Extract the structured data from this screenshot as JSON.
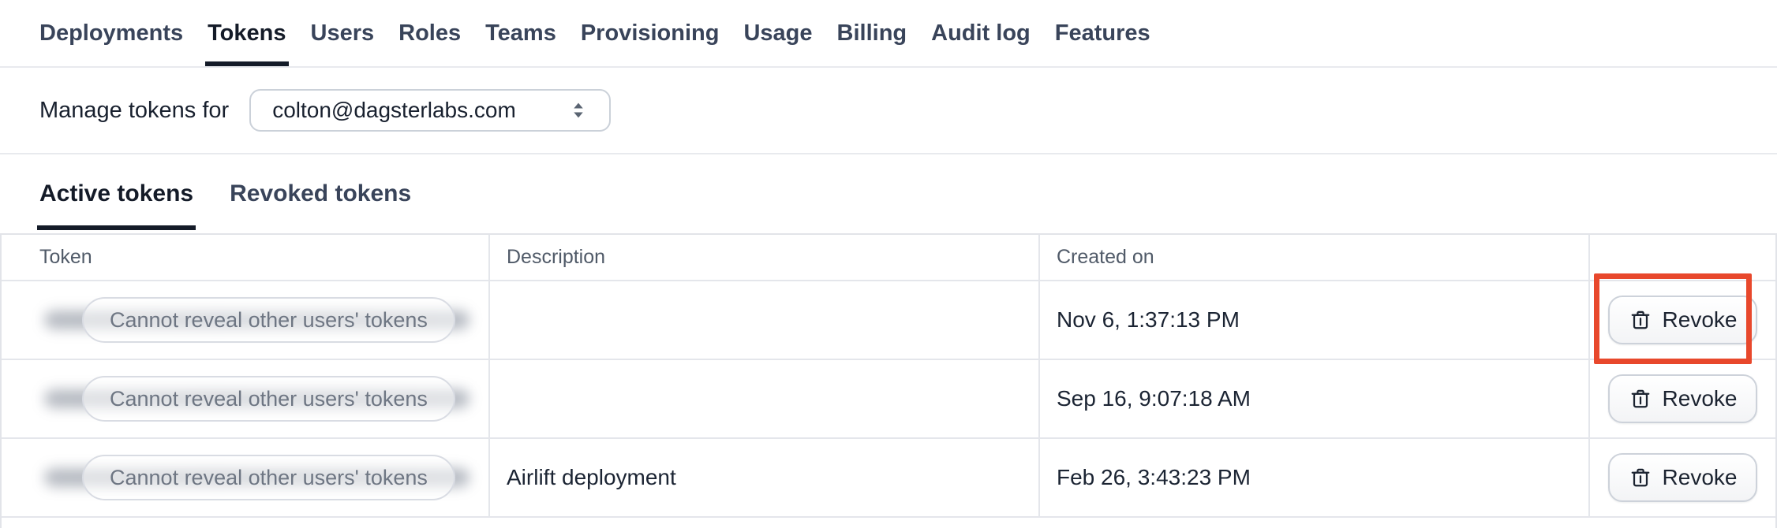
{
  "nav": {
    "tabs": [
      {
        "label": "Deployments",
        "active": false
      },
      {
        "label": "Tokens",
        "active": true
      },
      {
        "label": "Users",
        "active": false
      },
      {
        "label": "Roles",
        "active": false
      },
      {
        "label": "Teams",
        "active": false
      },
      {
        "label": "Provisioning",
        "active": false
      },
      {
        "label": "Usage",
        "active": false
      },
      {
        "label": "Billing",
        "active": false
      },
      {
        "label": "Audit log",
        "active": false
      },
      {
        "label": "Features",
        "active": false
      }
    ]
  },
  "manage": {
    "label": "Manage tokens for",
    "selected_user": "colton@dagsterlabs.com"
  },
  "token_tabs": [
    {
      "label": "Active tokens",
      "active": true
    },
    {
      "label": "Revoked tokens",
      "active": false
    }
  ],
  "table": {
    "columns": {
      "token": "Token",
      "description": "Description",
      "created_on": "Created on"
    },
    "rows": [
      {
        "token_masked": "Cannot reveal other users' tokens",
        "description": "",
        "created_on": "Nov 6, 1:37:13 PM",
        "action_label": "Revoke",
        "highlighted": true
      },
      {
        "token_masked": "Cannot reveal other users' tokens",
        "description": "",
        "created_on": "Sep 16, 9:07:18 AM",
        "action_label": "Revoke",
        "highlighted": false
      },
      {
        "token_masked": "Cannot reveal other users' tokens",
        "description": "Airlift deployment",
        "created_on": "Feb 26, 3:43:23 PM",
        "action_label": "Revoke",
        "highlighted": false
      }
    ]
  },
  "colors": {
    "highlight_red": "#E8482C",
    "accent_dark": "#141B28"
  },
  "icons": {
    "user_select_caret": "double-caret-vertical-icon",
    "revoke_button": "trash-icon"
  }
}
